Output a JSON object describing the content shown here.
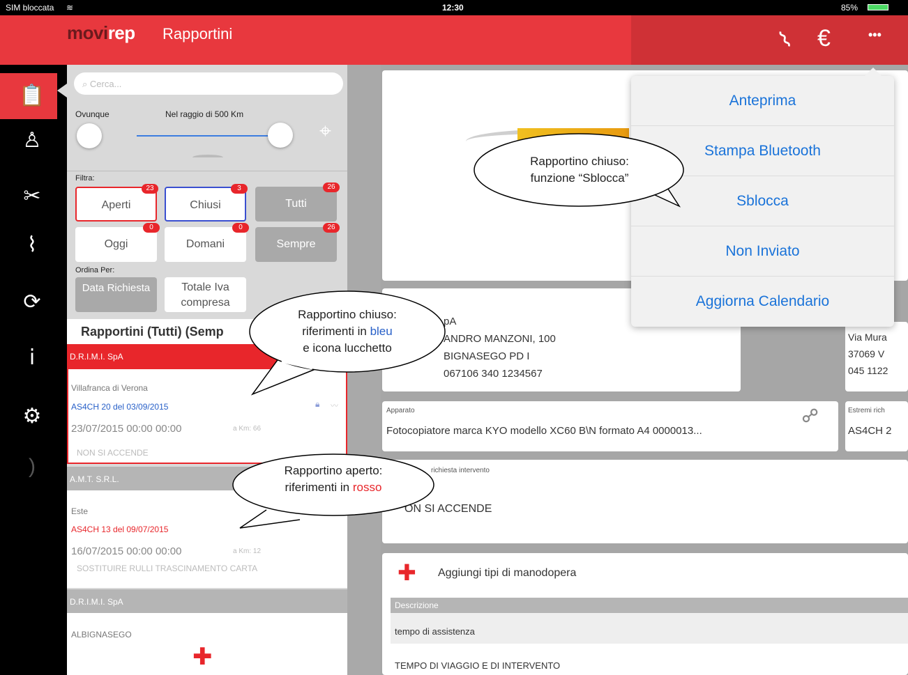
{
  "status": {
    "carrier": "SIM bloccata",
    "time": "12:30",
    "battery": "85%"
  },
  "nav": {
    "logo_prefix": "movi",
    "logo_suffix": "rep",
    "title": "Rapportini"
  },
  "search": {
    "placeholder": "Cerca..."
  },
  "range": {
    "anywhere": "Ovunque",
    "radius": "Nel raggio di 500 Km"
  },
  "filters": {
    "label": "Filtra:",
    "aperti": "Aperti",
    "aperti_count": "23",
    "chiusi": "Chiusi",
    "chiusi_count": "3",
    "tutti": "Tutti",
    "tutti_count": "26",
    "oggi": "Oggi",
    "oggi_count": "0",
    "domani": "Domani",
    "domani_count": "0",
    "sempre": "Sempre",
    "sempre_count": "26"
  },
  "sort": {
    "label": "Ordina Per:",
    "data": "Data Richiesta",
    "totale": "Totale Iva compresa"
  },
  "list": {
    "header": "Rapportini (Tutti) (Semp",
    "items": [
      {
        "customer": "D.R.I.M.I. SpA",
        "city": "Villafranca di Verona",
        "ref": "AS4CH 20 del 03/09/2015",
        "datetime": "23/07/2015  00:00  00:00",
        "km": "a Km: 66",
        "desc": "NON SI ACCENDE"
      },
      {
        "customer": "A.M.T. S.R.L.",
        "city": "Este",
        "ref": "AS4CH 13 del 09/07/2015",
        "datetime": "16/07/2015  00:00  00:00",
        "km": "a Km: 12",
        "desc": "SOSTITUIRE RULLI TRASCINAMENTO CARTA"
      },
      {
        "customer": "D.R.I.M.I. SpA",
        "city": "ALBIGNASEGO"
      }
    ]
  },
  "detail": {
    "client_name": "pA",
    "address": "ANDRO MANZONI, 100",
    "city": "BIGNASEGO  PD  I",
    "phones": "067106  340 1234567",
    "right_addr1": "Via Mura",
    "right_addr2": "37069  V",
    "right_addr3": "045 1122",
    "apparato_label": "Apparato",
    "apparato_value": "Fotocopiatore marca KYO modello XC60 B\\N formato A4  0000013...",
    "estremi_label": "Estremi rich",
    "estremi_value": "AS4CH 2",
    "richiesta_label": "richiesta intervento",
    "richiesta_value": "ON SI ACCENDE",
    "add_labor": "Aggiungi tipi di manodopera",
    "table_header": "Descrizione",
    "row1": "tempo di assistenza",
    "row2": "TEMPO DI VIAGGIO E DI INTERVENTO"
  },
  "menu": [
    "Anteprima",
    "Stampa Bluetooth",
    "Sblocca",
    "Non Inviato",
    "Aggiorna Calendario"
  ],
  "callouts": {
    "c1_l1": "Rapportino chiuso:",
    "c1_l2": "funzione “Sblocca”",
    "c2_l1": "Rapportino chiuso:",
    "c2_l2a": "riferimenti in ",
    "c2_l2b": "bleu",
    "c2_l3": "e icona lucchetto",
    "c3_l1": "Rapportino aperto:",
    "c3_l2a": "riferimenti in ",
    "c3_l2b": "rosso"
  }
}
